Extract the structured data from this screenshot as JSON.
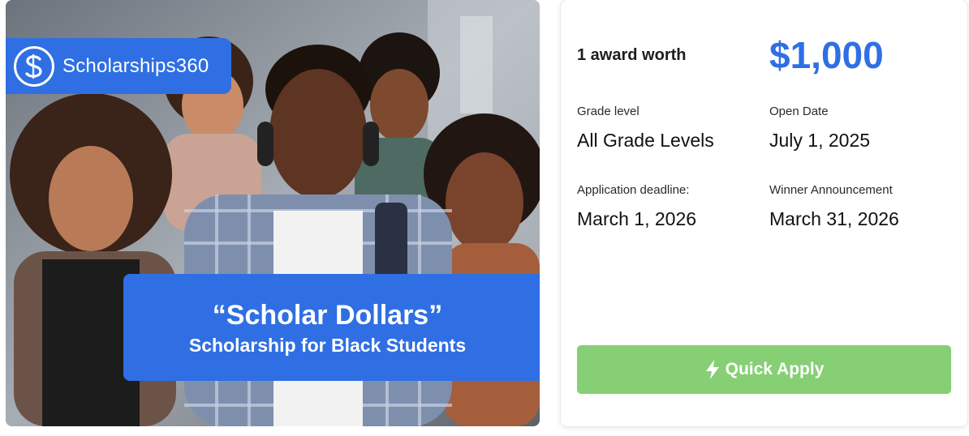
{
  "hero": {
    "brand_name": "Scholarships360",
    "logo_letter": "S",
    "banner_title": "“Scholar Dollars”",
    "banner_subtitle": "Scholarship for Black Students"
  },
  "card": {
    "award_label": "1 award worth",
    "award_amount": "$1,000",
    "grade_level_label": "Grade level",
    "grade_level_value": "All Grade Levels",
    "open_date_label": "Open Date",
    "open_date_value": "July 1, 2025",
    "deadline_label": "Application deadline:",
    "deadline_value": "March 1, 2026",
    "announcement_label": "Winner Announcement",
    "announcement_value": "March 31, 2026",
    "apply_label": "Quick Apply",
    "apply_icon": "lightning-bolt-icon"
  },
  "colors": {
    "brand_blue": "#2f6fe3",
    "apply_green": "#86cf75",
    "text_dark": "#111111"
  }
}
